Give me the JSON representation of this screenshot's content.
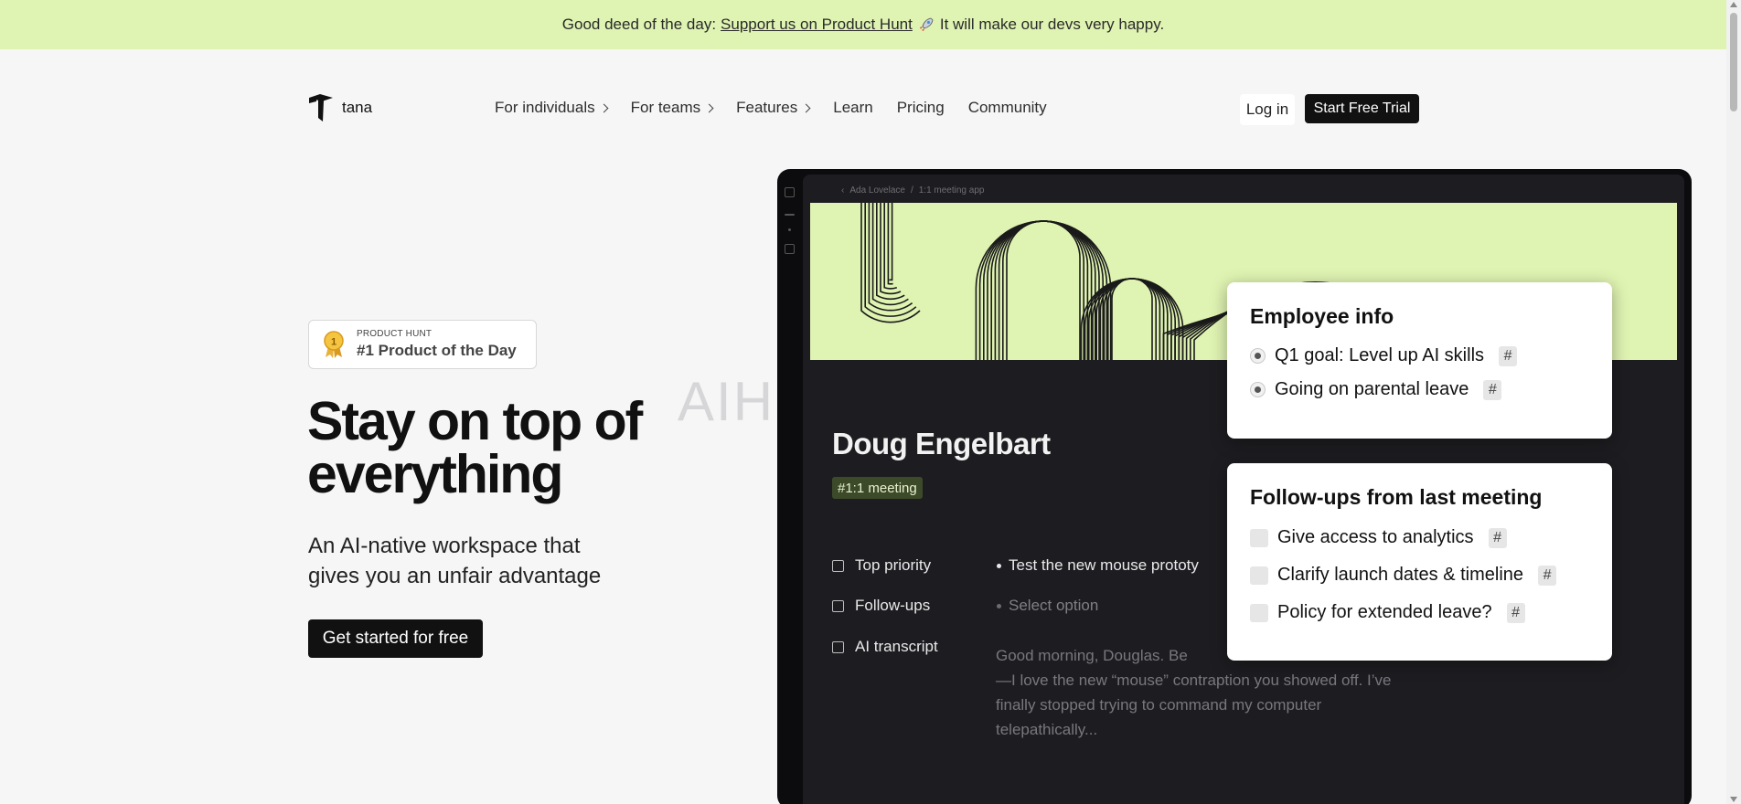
{
  "announcement": {
    "prefix": "Good deed of the day:",
    "link": "Support us on Product Hunt",
    "suffix": "It will make our devs very happy."
  },
  "header": {
    "logo_text": "tana",
    "nav": [
      {
        "label": "For individuals",
        "has_chevron": true
      },
      {
        "label": "For teams",
        "has_chevron": true
      },
      {
        "label": "Features",
        "has_chevron": true
      },
      {
        "label": "Learn",
        "has_chevron": false
      },
      {
        "label": "Pricing",
        "has_chevron": false
      },
      {
        "label": "Community",
        "has_chevron": false
      }
    ],
    "login": "Log in",
    "trial": "Start Free Trial"
  },
  "hero": {
    "badge_small": "PRODUCT HUNT",
    "badge_big": "#1 Product of the Day",
    "title": "Stay on top of everything",
    "subtitle": "An AI-native workspace that gives you an unfair advantage",
    "cta": "Get started for free",
    "watermark": "AIHI"
  },
  "app": {
    "breadcrumb_back": "‹",
    "breadcrumb_1": "Ada Lovelace",
    "breadcrumb_sep": "/",
    "breadcrumb_2": "1:1 meeting app",
    "name": "Doug Engelbart",
    "tag": "#1:1 meeting",
    "fields": [
      {
        "label": "Top priority",
        "value": "Test the new mouse prototy"
      },
      {
        "label": "Follow-ups",
        "value": "Select option"
      },
      {
        "label": "AI transcript",
        "value": "Good morning, Douglas. Be\n—I love the new “mouse” contraption you showed off. I’ve finally stopped trying to command my computer telepathically..."
      }
    ]
  },
  "employee_card": {
    "title": "Employee info",
    "items": [
      "Q1 goal: Level up AI skills",
      "Going on parental leave"
    ],
    "hash": "#"
  },
  "followups_card": {
    "title": "Follow-ups from last meeting",
    "items": [
      "Give access to analytics",
      "Clarify launch dates & timeline",
      "Policy for extended leave?"
    ],
    "hash": "#"
  },
  "colors": {
    "accent_green": "#dff3b2",
    "dark": "#111111",
    "app_bg": "#1d1d21"
  }
}
